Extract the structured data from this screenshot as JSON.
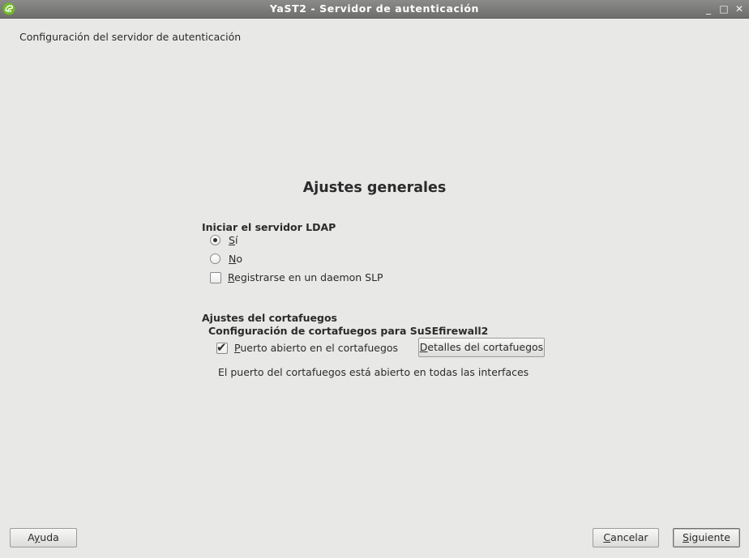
{
  "window": {
    "title": "YaST2 - Servidor de autenticación",
    "controls": {
      "minimize": "_",
      "maximize": "□",
      "close": "✕"
    },
    "icon": "yast-gecko-icon"
  },
  "header": {
    "label": "Configuración del servidor de autenticación"
  },
  "main": {
    "title": "Ajustes generales",
    "ldap": {
      "group_label": "Iniciar el servidor LDAP",
      "yes": {
        "label_u": "S",
        "label_rest": "í",
        "checked": true
      },
      "no": {
        "label_u": "N",
        "label_rest": "o",
        "checked": false
      },
      "slp": {
        "label_u": "R",
        "label_rest": "egistrarse en un daemon SLP",
        "checked": false
      }
    },
    "firewall": {
      "group_label": "Ajustes del cortafuegos",
      "sub_label": "Configuración de cortafuegos para SuSEfirewall2",
      "open_port": {
        "label_u": "P",
        "label_rest": "uerto abierto en el cortafuegos",
        "checked": true
      },
      "details_button": {
        "label_u": "D",
        "label_rest": "etalles del cortafuegos"
      },
      "info": "El puerto del cortafuegos está abierto en todas las interfaces"
    }
  },
  "footer": {
    "help": {
      "label_pre": "A",
      "label_u": "y",
      "label_rest": "uda"
    },
    "cancel": {
      "label_u": "C",
      "label_rest": "ancelar"
    },
    "next": {
      "label_u": "S",
      "label_rest": "iguiente"
    }
  }
}
